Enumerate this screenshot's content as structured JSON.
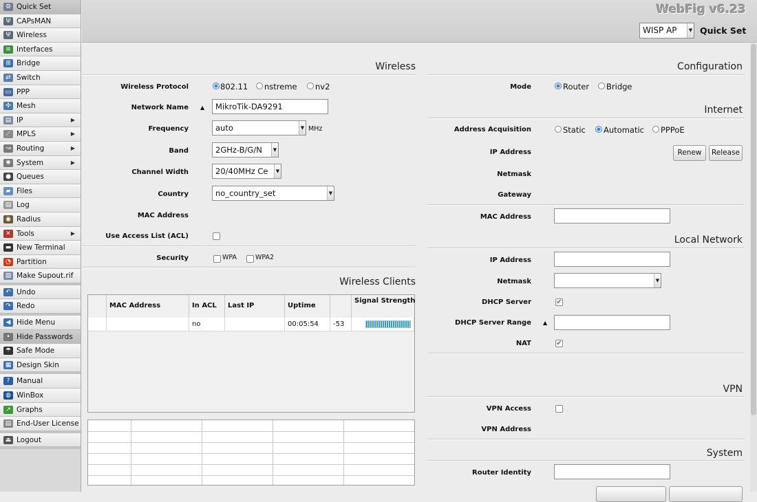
{
  "sidebar": {
    "items": [
      {
        "label": "Quick Set",
        "icon": "quickset-icon",
        "color": "#6f7f8f",
        "active": true,
        "submenu": false
      },
      {
        "label": "CAPsMAN",
        "icon": "antenna-icon",
        "color": "#5a6a7a",
        "submenu": false
      },
      {
        "label": "Wireless",
        "icon": "antenna-icon",
        "color": "#5a6a7a",
        "submenu": false
      },
      {
        "label": "Interfaces",
        "icon": "interfaces-icon",
        "color": "#3f8f3f",
        "submenu": false
      },
      {
        "label": "Bridge",
        "icon": "bridge-icon",
        "color": "#3b6fb0",
        "submenu": false
      },
      {
        "label": "Switch",
        "icon": "switch-icon",
        "color": "#5b7fa8",
        "submenu": false
      },
      {
        "label": "PPP",
        "icon": "ppp-icon",
        "color": "#4a6a9a",
        "submenu": false
      },
      {
        "label": "Mesh",
        "icon": "mesh-icon",
        "color": "#4a7aaa",
        "submenu": false
      },
      {
        "label": "IP",
        "icon": "ip-icon",
        "color": "#7a8a9a",
        "submenu": true
      },
      {
        "label": "MPLS",
        "icon": "mpls-icon",
        "color": "#8a8a8a",
        "submenu": true
      },
      {
        "label": "Routing",
        "icon": "routing-icon",
        "color": "#7a7a7a",
        "submenu": true
      },
      {
        "label": "System",
        "icon": "gear-icon",
        "color": "#7a7a7a",
        "submenu": true
      },
      {
        "label": "Queues",
        "icon": "queues-icon",
        "color": "#444444",
        "submenu": false
      },
      {
        "label": "Files",
        "icon": "folder-icon",
        "color": "#6a8fb8",
        "submenu": false
      },
      {
        "label": "Log",
        "icon": "log-icon",
        "color": "#9a9a9a",
        "submenu": false
      },
      {
        "label": "Radius",
        "icon": "radius-icon",
        "color": "#6a5a3a",
        "submenu": false
      },
      {
        "label": "Tools",
        "icon": "tools-icon",
        "color": "#b03a2a",
        "submenu": true
      },
      {
        "label": "New Terminal",
        "icon": "terminal-icon",
        "color": "#333333",
        "submenu": false
      },
      {
        "label": "Partition",
        "icon": "partition-icon",
        "color": "#c8401a",
        "submenu": false
      },
      {
        "label": "Make Supout.rif",
        "icon": "supout-icon",
        "color": "#7a8aa8",
        "submenu": false
      }
    ],
    "group2": [
      {
        "label": "Undo",
        "icon": "undo-icon",
        "color": "#3a6fb0"
      },
      {
        "label": "Redo",
        "icon": "redo-icon",
        "color": "#3a6fb0"
      }
    ],
    "group3": [
      {
        "label": "Hide Menu",
        "icon": "hide-menu-icon",
        "color": "#3a6fb0"
      },
      {
        "label": "Hide Passwords",
        "icon": "hide-passwords-icon",
        "color": "#777777",
        "active": true
      },
      {
        "label": "Safe Mode",
        "icon": "umbrella-icon",
        "color": "#333333"
      },
      {
        "label": "Design Skin",
        "icon": "design-skin-icon",
        "color": "#3a6fb0"
      }
    ],
    "group4": [
      {
        "label": "Manual",
        "icon": "help-icon",
        "color": "#2a5fa8"
      },
      {
        "label": "WinBox",
        "icon": "winbox-icon",
        "color": "#1a4f98"
      },
      {
        "label": "Graphs",
        "icon": "graphs-icon",
        "color": "#3a9a3a"
      },
      {
        "label": "End-User License",
        "icon": "license-icon",
        "color": "#888888"
      }
    ],
    "group5": [
      {
        "label": "Logout",
        "icon": "logout-icon",
        "color": "#555555"
      }
    ]
  },
  "header": {
    "brand": "WebFig v6.23",
    "preset": "WISP AP",
    "title": "Quick Set"
  },
  "wireless": {
    "title": "Wireless",
    "protocol_label": "Wireless Protocol",
    "protocol_options": [
      "802.11",
      "nstreme",
      "nv2"
    ],
    "network_name_label": "Network Name",
    "network_name": "MikroTik-DA9291",
    "frequency_label": "Frequency",
    "frequency": "auto",
    "frequency_unit": "MHz",
    "band_label": "Band",
    "band": "2GHz-B/G/N",
    "channel_width_label": "Channel Width",
    "channel_width": "20/40MHz Ce",
    "country_label": "Country",
    "country": "no_country_set",
    "mac_label": "MAC Address",
    "acl_label": "Use Access List (ACL)",
    "security_label": "Security",
    "security_options": [
      "WPA",
      "WPA2"
    ]
  },
  "clients": {
    "title": "Wireless Clients",
    "columns": [
      "MAC Address",
      "In ACL",
      "Last IP",
      "Uptime",
      "Signal Strength"
    ],
    "row": {
      "mac": "",
      "in_acl": "no",
      "last_ip": "",
      "uptime": "00:05:54",
      "signal": "-53"
    }
  },
  "configuration": {
    "title": "Configuration",
    "mode_label": "Mode",
    "mode_options": [
      "Router",
      "Bridge"
    ]
  },
  "internet": {
    "title": "Internet",
    "acq_label": "Address Acquisition",
    "acq_options": [
      "Static",
      "Automatic",
      "PPPoE"
    ],
    "ip_label": "IP Address",
    "renew_label": "Renew",
    "release_label": "Release",
    "netmask_label": "Netmask",
    "gateway_label": "Gateway",
    "mac_label": "MAC Address"
  },
  "local": {
    "title": "Local Network",
    "ip_label": "IP Address",
    "netmask_label": "Netmask",
    "dhcp_label": "DHCP Server",
    "dhcp_range_label": "DHCP Server Range",
    "nat_label": "NAT"
  },
  "vpn": {
    "title": "VPN",
    "access_label": "VPN Access",
    "address_label": "VPN Address"
  },
  "system": {
    "title": "System",
    "identity_label": "Router Identity"
  }
}
